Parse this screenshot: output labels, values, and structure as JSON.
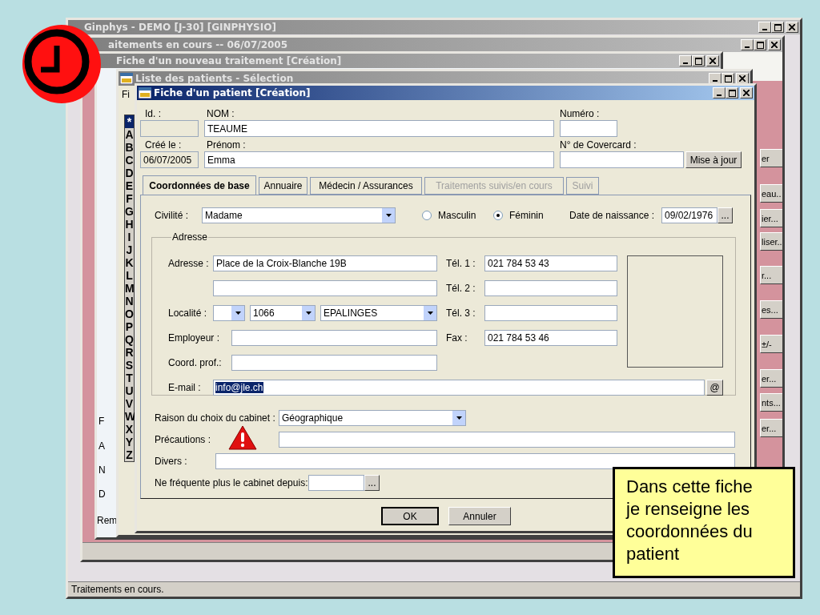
{
  "slide": {
    "callout": "Dans cette fiche je renseigne les coordonnées du patient"
  },
  "main_window": {
    "title": "Ginphys - DEMO [J-30] [GINPHYSIO]",
    "status_bar": "Traitements en cours."
  },
  "treatments_window": {
    "title": "aitements en cours  --  06/07/2005",
    "side_buttons": [
      "er",
      "eau..",
      "ier...",
      "liser..",
      "r...",
      "es...",
      "±/-",
      "er...",
      "nts...",
      "er..."
    ]
  },
  "treatment_window": {
    "title": "Fiche d'un nouveau traitement [Création]",
    "fragments": [
      "F",
      "A",
      "N",
      "D",
      "Rem"
    ]
  },
  "patient_list_window": {
    "title": "Liste des patients - Sélection",
    "menu": "Fi",
    "letters": [
      {
        "label": "*",
        "selected": true
      },
      {
        "label": "A",
        "selected": false
      },
      {
        "label": "B",
        "selected": false
      },
      {
        "label": "C",
        "selected": false
      },
      {
        "label": "D",
        "selected": false
      },
      {
        "label": "E",
        "selected": false
      },
      {
        "label": "F",
        "selected": false
      },
      {
        "label": "G",
        "selected": false
      },
      {
        "label": "H",
        "selected": false
      },
      {
        "label": "I",
        "selected": false
      },
      {
        "label": "J",
        "selected": false
      },
      {
        "label": "K",
        "selected": false
      },
      {
        "label": "L",
        "selected": false
      },
      {
        "label": "M",
        "selected": false
      },
      {
        "label": "N",
        "selected": false
      },
      {
        "label": "O",
        "selected": false
      },
      {
        "label": "P",
        "selected": false
      },
      {
        "label": "Q",
        "selected": false
      },
      {
        "label": "R",
        "selected": false
      },
      {
        "label": "S",
        "selected": false
      },
      {
        "label": "T",
        "selected": false
      },
      {
        "label": "U",
        "selected": false
      },
      {
        "label": "V",
        "selected": false
      },
      {
        "label": "W",
        "selected": false
      },
      {
        "label": "X",
        "selected": false
      },
      {
        "label": "Y",
        "selected": false
      },
      {
        "label": "Z",
        "selected": false
      }
    ]
  },
  "patient_window": {
    "title": "Fiche d'un patient [Création]",
    "header": {
      "id_label": "Id. :",
      "name_label": "NOM :",
      "name": "TEAUME",
      "number_label": "Numéro :",
      "created_label": "Créé le :",
      "created": "06/07/2005",
      "first_name_label": "Prénom :",
      "first_name": "Emma",
      "covercard_label": "N° de Covercard :",
      "update_button": "Mise à jour"
    },
    "tabs": [
      {
        "label": "Coordonnées de base",
        "selected": true,
        "disabled": false
      },
      {
        "label": "Annuaire",
        "selected": false,
        "disabled": false
      },
      {
        "label": "Médecin / Assurances",
        "selected": false,
        "disabled": false
      },
      {
        "label": "Traitements suivis/en cours",
        "selected": false,
        "disabled": true
      },
      {
        "label": "Suivi",
        "selected": false,
        "disabled": true
      }
    ],
    "civility": {
      "label": "Civilité :",
      "value": "Madame"
    },
    "gender": [
      {
        "label": "Masculin",
        "selected": false
      },
      {
        "label": "Féminin",
        "selected": true
      }
    ],
    "birth_date": {
      "label": "Date de naissance :",
      "value": "09/02/1976",
      "button": "..."
    },
    "address": {
      "legend": "Adresse",
      "address_label": "Adresse :",
      "line_1": "Place de la Croix-Blanche 19B",
      "locality_label": "Localité :",
      "locality": [
        {
          "value": "1066"
        },
        {
          "value": "EPALINGES"
        }
      ],
      "employer_label": "Employeur :",
      "professional_label": "Coord. prof.:",
      "email": {
        "label": "E-mail :",
        "value": "info@jle.ch",
        "highlighted": true
      },
      "email_button": "@",
      "phones": [
        {
          "label": "Tél. 1 :",
          "value": "021 784 53 43"
        },
        {
          "label": "Tél. 2 :"
        },
        {
          "label": "Tél. 3 :"
        },
        {
          "label": "Fax :",
          "value": "021 784 53 46"
        }
      ]
    },
    "reason": {
      "label": "Raison du choix du cabinet :",
      "value": "Géographique"
    },
    "precautions": {
      "label": "Précautions :",
      "warning": true
    },
    "misc": {
      "label": "Divers :"
    },
    "left_since": {
      "label": "Ne fréquente plus le cabinet depuis:",
      "button": "..."
    },
    "buttons": [
      {
        "label": "OK",
        "default": true
      },
      {
        "label": "Annuler",
        "default": false
      }
    ]
  }
}
